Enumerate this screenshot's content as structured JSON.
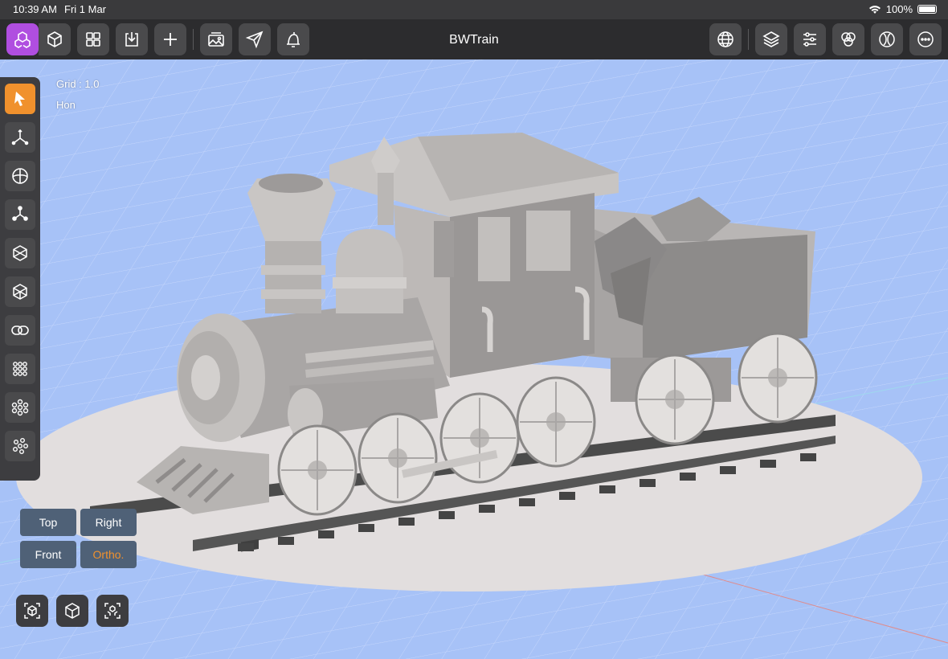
{
  "status": {
    "time": "10:39 AM",
    "date": "Fri 1 Mar",
    "battery": "100%"
  },
  "app": {
    "title": "BWTrain"
  },
  "viewport": {
    "grid_label": "Grid : 1.0",
    "mode_label": "Hon"
  },
  "view_buttons": {
    "top": "Top",
    "right": "Right",
    "front": "Front",
    "ortho": "Ortho."
  },
  "colors": {
    "accent_purple": "#b04ee0",
    "accent_orange": "#f0912d",
    "background": "#a7c2f7",
    "toolbar": "#2c2c2e"
  },
  "toolbar_icons": {
    "left": [
      "objects-icon",
      "cube-icon",
      "grid-view-icon",
      "import-icon",
      "add-icon",
      "gallery-icon",
      "send-icon",
      "notes-icon"
    ],
    "right": [
      "globe-icon",
      "layers-icon",
      "sliders-icon",
      "materials-icon",
      "render-icon",
      "more-icon"
    ]
  },
  "side_tools": [
    "select-icon",
    "move-icon",
    "rotate-icon",
    "pivot-icon",
    "box-select-icon",
    "box-deselect-icon",
    "link-icon",
    "array-icon",
    "cluster-icon",
    "scatter-icon"
  ],
  "camera_buttons": [
    "camera-frame-icon",
    "camera-cube-icon",
    "camera-objects-icon"
  ]
}
